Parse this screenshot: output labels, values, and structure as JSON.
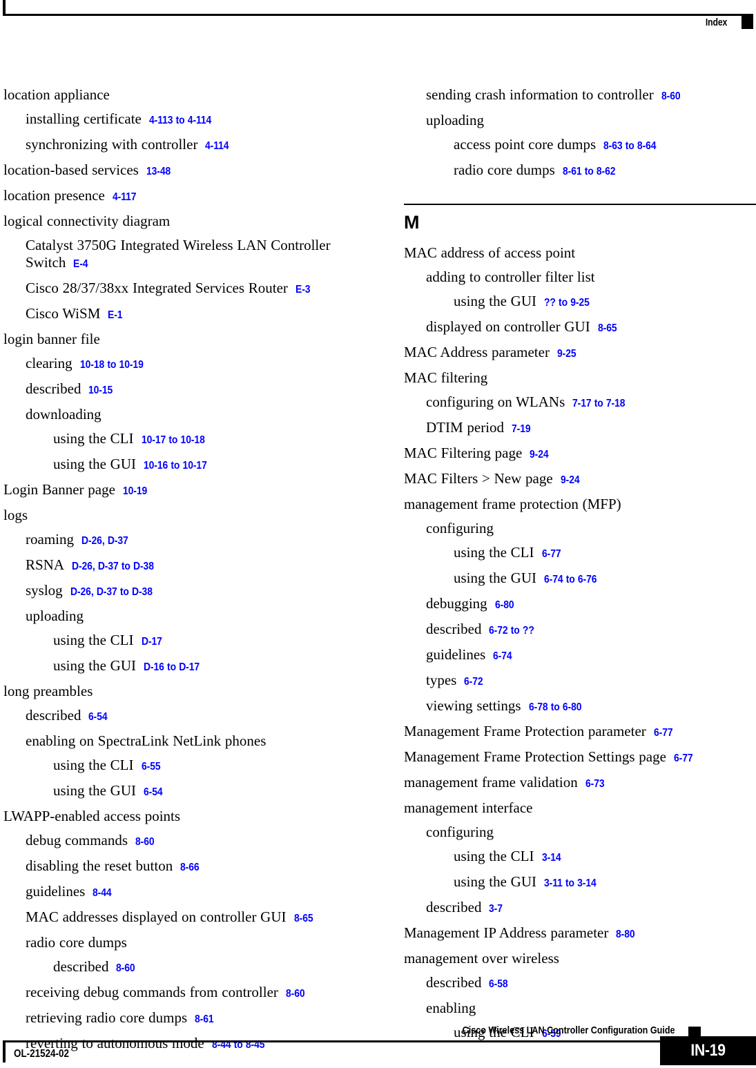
{
  "header": {
    "title": "Index"
  },
  "footer": {
    "guide_title": "Cisco Wireless LAN Controller Configuration Guide",
    "doc_id": "OL-21524-02",
    "page_number": "IN-19"
  },
  "colors": {
    "page_reference": "#0000ff",
    "text": "#000000",
    "background": "#ffffff"
  },
  "columns": [
    {
      "name": "left-column",
      "entries": [
        {
          "level": 0,
          "term": "location appliance",
          "ref": ""
        },
        {
          "level": 1,
          "term": "installing certificate",
          "ref": "4-113 to 4-114"
        },
        {
          "level": 1,
          "term": "synchronizing with controller",
          "ref": "4-114"
        },
        {
          "level": 0,
          "term": "location-based services",
          "ref": "13-48"
        },
        {
          "level": 0,
          "term": "location presence",
          "ref": "4-117"
        },
        {
          "level": 0,
          "term": "logical connectivity diagram",
          "ref": ""
        },
        {
          "level": 1,
          "term": "Catalyst 3750G Integrated Wireless LAN Controller Switch",
          "ref": "E-4",
          "wrapped": true
        },
        {
          "level": 1,
          "term": "Cisco 28/37/38xx Integrated Services Router",
          "ref": "E-3"
        },
        {
          "level": 1,
          "term": "Cisco WiSM",
          "ref": "E-1"
        },
        {
          "level": 0,
          "term": "login banner file",
          "ref": ""
        },
        {
          "level": 1,
          "term": "clearing",
          "ref": "10-18 to 10-19"
        },
        {
          "level": 1,
          "term": "described",
          "ref": "10-15"
        },
        {
          "level": 1,
          "term": "downloading",
          "ref": ""
        },
        {
          "level": 2,
          "term": "using the CLI",
          "ref": "10-17 to 10-18"
        },
        {
          "level": 2,
          "term": "using the GUI",
          "ref": "10-16 to 10-17"
        },
        {
          "level": 0,
          "term": "Login Banner page",
          "ref": "10-19"
        },
        {
          "level": 0,
          "term": "logs",
          "ref": ""
        },
        {
          "level": 1,
          "term": "roaming",
          "ref": "D-26, D-37"
        },
        {
          "level": 1,
          "term": "RSNA",
          "ref": "D-26, D-37 to D-38"
        },
        {
          "level": 1,
          "term": "syslog",
          "ref": "D-26, D-37 to D-38"
        },
        {
          "level": 1,
          "term": "uploading",
          "ref": ""
        },
        {
          "level": 2,
          "term": "using the CLI",
          "ref": "D-17"
        },
        {
          "level": 2,
          "term": "using the GUI",
          "ref": "D-16 to D-17"
        },
        {
          "level": 0,
          "term": "long preambles",
          "ref": ""
        },
        {
          "level": 1,
          "term": "described",
          "ref": "6-54"
        },
        {
          "level": 1,
          "term": "enabling on SpectraLink NetLink phones",
          "ref": ""
        },
        {
          "level": 2,
          "term": "using the CLI",
          "ref": "6-55"
        },
        {
          "level": 2,
          "term": "using the GUI",
          "ref": "6-54"
        },
        {
          "level": 0,
          "term": "LWAPP-enabled access points",
          "ref": ""
        },
        {
          "level": 1,
          "term": "debug commands",
          "ref": "8-60"
        },
        {
          "level": 1,
          "term": "disabling the reset button",
          "ref": "8-66"
        },
        {
          "level": 1,
          "term": "guidelines",
          "ref": "8-44"
        },
        {
          "level": 1,
          "term": "MAC addresses displayed on controller GUI",
          "ref": "8-65"
        },
        {
          "level": 1,
          "term": "radio core dumps",
          "ref": ""
        },
        {
          "level": 2,
          "term": "described",
          "ref": "8-60"
        },
        {
          "level": 1,
          "term": "receiving debug commands from controller",
          "ref": "8-60"
        },
        {
          "level": 1,
          "term": "retrieving radio core dumps",
          "ref": "8-61"
        },
        {
          "level": 1,
          "term": "reverting to autonomous mode",
          "ref": "8-44 to 8-45"
        }
      ]
    },
    {
      "name": "right-column",
      "entries": [
        {
          "level": 1,
          "term": "sending crash information to controller",
          "ref": "8-60"
        },
        {
          "level": 1,
          "term": "uploading",
          "ref": ""
        },
        {
          "level": 2,
          "term": "access point core dumps",
          "ref": "8-63 to 8-64"
        },
        {
          "level": 2,
          "term": "radio core dumps",
          "ref": "8-61 to 8-62"
        },
        {
          "section": "M"
        },
        {
          "level": 0,
          "term": "MAC address of access point",
          "ref": ""
        },
        {
          "level": 1,
          "term": "adding to controller filter list",
          "ref": ""
        },
        {
          "level": 2,
          "term": "using the GUI",
          "ref": "?? to 9-25"
        },
        {
          "level": 1,
          "term": "displayed on controller GUI",
          "ref": "8-65"
        },
        {
          "level": 0,
          "term": "MAC Address parameter",
          "ref": "9-25"
        },
        {
          "level": 0,
          "term": "MAC filtering",
          "ref": ""
        },
        {
          "level": 1,
          "term": "configuring on WLANs",
          "ref": "7-17 to 7-18"
        },
        {
          "level": 1,
          "term": "DTIM period",
          "ref": "7-19"
        },
        {
          "level": 0,
          "term": "MAC Filtering page",
          "ref": "9-24"
        },
        {
          "level": 0,
          "term": "MAC Filters > New page",
          "ref": "9-24"
        },
        {
          "level": 0,
          "term": "management frame protection (MFP)",
          "ref": ""
        },
        {
          "level": 1,
          "term": "configuring",
          "ref": ""
        },
        {
          "level": 2,
          "term": "using the CLI",
          "ref": "6-77"
        },
        {
          "level": 2,
          "term": "using the GUI",
          "ref": "6-74 to 6-76"
        },
        {
          "level": 1,
          "term": "debugging",
          "ref": "6-80"
        },
        {
          "level": 1,
          "term": "described",
          "ref": "6-72 to ??"
        },
        {
          "level": 1,
          "term": "guidelines",
          "ref": "6-74"
        },
        {
          "level": 1,
          "term": "types",
          "ref": "6-72"
        },
        {
          "level": 1,
          "term": "viewing settings",
          "ref": "6-78 to 6-80"
        },
        {
          "level": 0,
          "term": "Management Frame Protection parameter",
          "ref": "6-77"
        },
        {
          "level": 0,
          "term": "Management Frame Protection Settings page",
          "ref": "6-77"
        },
        {
          "level": 0,
          "term": "management frame validation",
          "ref": "6-73"
        },
        {
          "level": 0,
          "term": "management interface",
          "ref": ""
        },
        {
          "level": 1,
          "term": "configuring",
          "ref": ""
        },
        {
          "level": 2,
          "term": "using the CLI",
          "ref": "3-14"
        },
        {
          "level": 2,
          "term": "using the GUI",
          "ref": "3-11 to 3-14"
        },
        {
          "level": 1,
          "term": "described",
          "ref": "3-7"
        },
        {
          "level": 0,
          "term": "Management IP Address parameter",
          "ref": "8-80"
        },
        {
          "level": 0,
          "term": "management over wireless",
          "ref": ""
        },
        {
          "level": 1,
          "term": "described",
          "ref": "6-58"
        },
        {
          "level": 1,
          "term": "enabling",
          "ref": ""
        },
        {
          "level": 2,
          "term": "using the CLI",
          "ref": "6-59"
        }
      ]
    }
  ]
}
